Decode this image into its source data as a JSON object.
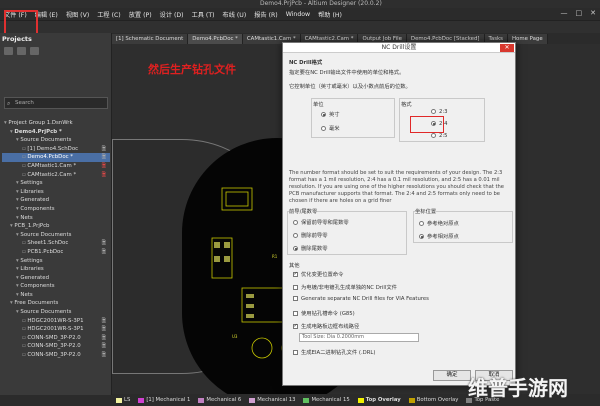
{
  "window": {
    "title": "Demo4.PrjPcb - Altium Designer (20.0.2)"
  },
  "menu": [
    "文件 (F)",
    "编辑 (E)",
    "视图 (V)",
    "工程 (C)",
    "放置 (P)",
    "设计 (D)",
    "工具 (T)",
    "布线 (U)",
    "报告 (R)",
    "Window",
    "帮助 (H)"
  ],
  "window_controls": [
    "—",
    "□",
    "✕"
  ],
  "projects": {
    "title": "Projects",
    "search_placeholder": "Search",
    "tree": [
      {
        "label": "Project Group 1.DsnWrk",
        "indent": 0,
        "doc": ""
      },
      {
        "label": "Demo4.PrjPcb *",
        "indent": 1,
        "doc": "",
        "bold": true
      },
      {
        "label": "Source Documents",
        "indent": 2,
        "doc": ""
      },
      {
        "label": "[1] Demo4.SchDoc",
        "indent": 3,
        "doc": "🗎"
      },
      {
        "label": "Demo4.PcbDoc *",
        "indent": 3,
        "doc": "🗎",
        "sel": true
      },
      {
        "label": "CAMtastic1.Cam *",
        "indent": 3,
        "doc": "🗎",
        "red": true
      },
      {
        "label": "CAMtastic2.Cam *",
        "indent": 3,
        "doc": "🗎",
        "red": true
      },
      {
        "label": "Settings",
        "indent": 2,
        "doc": ""
      },
      {
        "label": "Libraries",
        "indent": 2,
        "doc": ""
      },
      {
        "label": "Generated",
        "indent": 2,
        "doc": ""
      },
      {
        "label": "Components",
        "indent": 2,
        "doc": ""
      },
      {
        "label": "Nets",
        "indent": 2,
        "doc": ""
      },
      {
        "label": "PCB_1.PrjPcb",
        "indent": 1,
        "doc": ""
      },
      {
        "label": "Source Documents",
        "indent": 2,
        "doc": ""
      },
      {
        "label": "Sheet1.SchDoc",
        "indent": 3,
        "doc": "🗎"
      },
      {
        "label": "PCB1.PcbDoc",
        "indent": 3,
        "doc": "🗎"
      },
      {
        "label": "Settings",
        "indent": 2,
        "doc": ""
      },
      {
        "label": "Libraries",
        "indent": 2,
        "doc": ""
      },
      {
        "label": "Generated",
        "indent": 2,
        "doc": ""
      },
      {
        "label": "Components",
        "indent": 2,
        "doc": ""
      },
      {
        "label": "Nets",
        "indent": 2,
        "doc": ""
      },
      {
        "label": "Free Documents",
        "indent": 1,
        "doc": ""
      },
      {
        "label": "Source Documents",
        "indent": 2,
        "doc": ""
      },
      {
        "label": "HDGC2001WR-S-3P1",
        "indent": 3,
        "doc": "🗎"
      },
      {
        "label": "HDGC2001WR-S-3P1",
        "indent": 3,
        "doc": "🗎"
      },
      {
        "label": "CONN-SMD_3P-P2.0",
        "indent": 3,
        "doc": "🗎"
      },
      {
        "label": "CONN-SMD_3P-P2.0",
        "indent": 3,
        "doc": "🗎"
      },
      {
        "label": "CONN-SMD_3P-P2.0",
        "indent": 3,
        "doc": "🗎"
      }
    ]
  },
  "tabs": [
    {
      "label": "[1] Schematic Document",
      "active": false
    },
    {
      "label": "Demo4.PcbDoc *",
      "active": true
    },
    {
      "label": "CAMtastic1.Cam *",
      "active": false
    },
    {
      "label": "CAMtastic2.Cam *",
      "active": false
    },
    {
      "label": "Output Job File",
      "active": false
    },
    {
      "label": "Demo4.PcbDoc [Stacked]",
      "active": false
    },
    {
      "label": "Tasks",
      "active": false
    },
    {
      "label": "Home Page",
      "active": false
    }
  ],
  "pcb": {
    "red_note": "然后生产钻孔文件"
  },
  "dialog": {
    "title": "NC Drill设置",
    "close": "✕",
    "section_format": "NC Drill格式",
    "desc1": "指定要在NC Drill输出文件中使用的单位和格式。",
    "desc2": "它控制单位（英寸或毫米）以及小数点前后的位数。",
    "units_label": "单位",
    "unit_inch": "英寸",
    "unit_mm": "毫米",
    "format_label": "格式",
    "format_options": [
      "2:3",
      "2:4",
      "2:5"
    ],
    "format_selected": "2:4",
    "note": "The number format should be set to suit the requirements of your design. The 2:3 format has a 1 mil resolution, 2:4 has a 0.1 mil resolution, and 2:5 has a 0.01 mil resolution. If you are using one of the higher resolutions you should check that the PCB manufacturer supports that format. The 2:4 and 2:5 formats only need to be chosen if there are holes on a grid finer",
    "leading_label": "前导/尾数零",
    "leading_options": [
      "保留前导零和尾数零",
      "删除前导零",
      "删除尾数零"
    ],
    "leading_selected": 2,
    "coord_label": "坐标位置",
    "coord_options": [
      "参考绝对原点",
      "参考相对原点"
    ],
    "coord_selected": 1,
    "other_label": "其他",
    "other_options": [
      {
        "label": "优化变更位置命令",
        "checked": true
      },
      {
        "label": "为电镀/非电镀孔生成单独的NC Drill文件",
        "checked": false
      },
      {
        "label": "Generate separate NC Drill files for VIA Features",
        "checked": false
      },
      {
        "label": "使用钻孔槽命令 (G85)",
        "checked": false
      },
      {
        "label": "生成电路板边框布线路径",
        "checked": true
      },
      {
        "label": "生成EIA二进制钻孔文件 (.DRL)",
        "checked": false
      }
    ],
    "input_value": "Tool Size: Dia 0.2000mm",
    "ok": "确定",
    "cancel": "取消"
  },
  "layers": [
    {
      "label": "LS",
      "color": "#f2f2a0"
    },
    {
      "label": "[1] Mechanical 1",
      "color": "#d040d0"
    },
    {
      "label": "Mechanical 6",
      "color": "#c080c0"
    },
    {
      "label": "Mechanical 13",
      "color": "#d0a0d0"
    },
    {
      "label": "Mechanical 15",
      "color": "#60c060"
    },
    {
      "label": "Top Overlay",
      "color": "#f0f000",
      "bold": true
    },
    {
      "label": "Bottom Overlay",
      "color": "#c0a000"
    },
    {
      "label": "Top Paste",
      "color": "#808080"
    }
  ],
  "watermark": "维普手游网"
}
